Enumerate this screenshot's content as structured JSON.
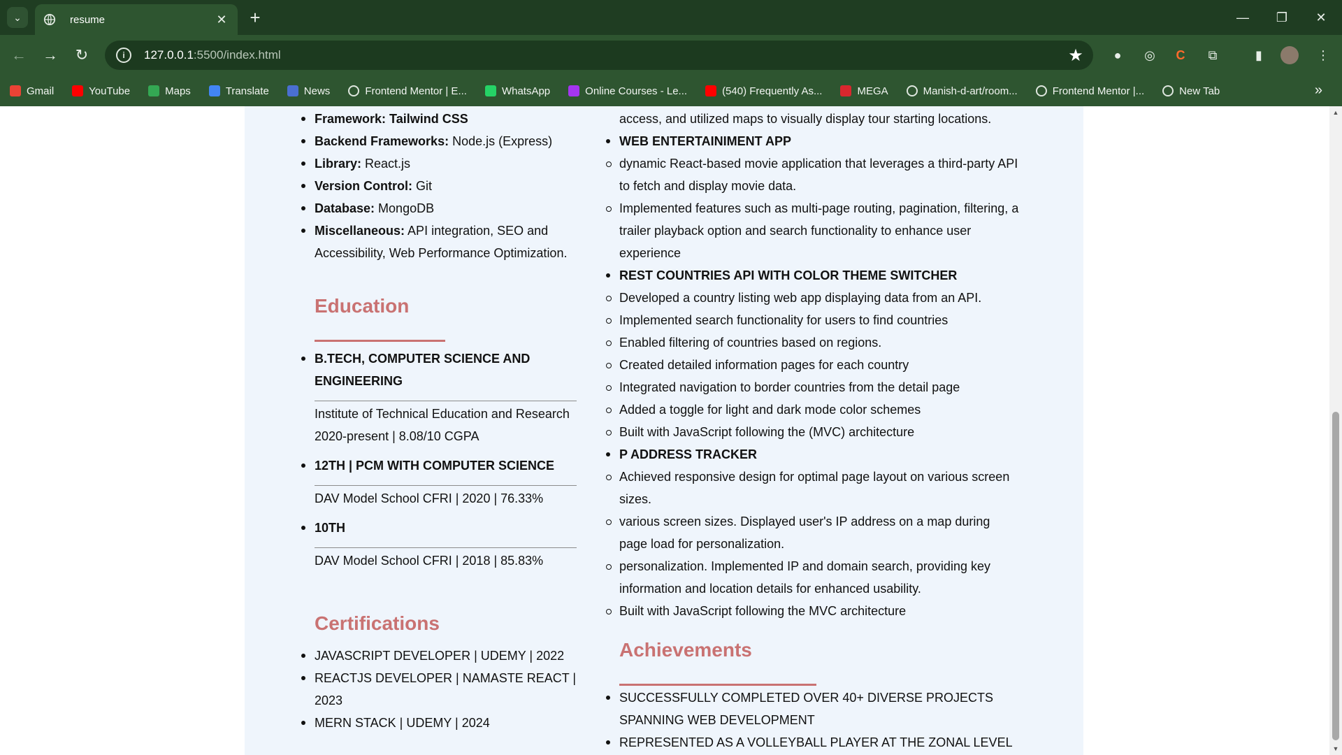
{
  "browser": {
    "tab_title": "resume",
    "url_host": "127.0.0.1",
    "url_path": ":5500/index.html",
    "bookmarks": [
      {
        "label": "Gmail",
        "icon": "gmail-icon",
        "color": "#ea4335"
      },
      {
        "label": "YouTube",
        "icon": "youtube-icon",
        "color": "#ff0000"
      },
      {
        "label": "Maps",
        "icon": "maps-icon",
        "color": "#34a853"
      },
      {
        "label": "Translate",
        "icon": "translate-icon",
        "color": "#4285f4"
      },
      {
        "label": "News",
        "icon": "news-icon",
        "color": "#4a6fd1"
      },
      {
        "label": "Frontend Mentor | E...",
        "icon": "frontend-mentor-icon",
        "color": "#ffffff"
      },
      {
        "label": "WhatsApp",
        "icon": "whatsapp-icon",
        "color": "#25d366"
      },
      {
        "label": "Online Courses - Le...",
        "icon": "udemy-icon",
        "color": "#a435f0"
      },
      {
        "label": "(540) Frequently As...",
        "icon": "youtube-icon",
        "color": "#ff0000"
      },
      {
        "label": "MEGA",
        "icon": "mega-icon",
        "color": "#d9272e"
      },
      {
        "label": "Manish-d-art/room...",
        "icon": "github-icon",
        "color": "#ffffff"
      },
      {
        "label": "Frontend Mentor |...",
        "icon": "globe-icon",
        "color": "#ffffff"
      },
      {
        "label": "New Tab",
        "icon": "globe-icon",
        "color": "#ffffff"
      }
    ]
  },
  "skills": {
    "items": [
      {
        "label": "Framework:",
        "value": " Tailwind CSS",
        "value_bold": true
      },
      {
        "label": "Backend Frameworks:",
        "value": " Node.js (Express)"
      },
      {
        "label": "Library:",
        "value": " React.js"
      },
      {
        "label": "Version Control:",
        "value": " Git"
      },
      {
        "label": "Database:",
        "value": " MongoDB"
      },
      {
        "label": "Miscellaneous:",
        "value": " API integration, SEO and Accessibility, Web Performance Optimization."
      }
    ]
  },
  "education": {
    "title": "Education",
    "entries": [
      {
        "degree": "B.TECH, COMPUTER SCIENCE AND ENGINEERING",
        "details": [
          "Institute of Technical Education and Research",
          "2020-present | 8.08/10 CGPA"
        ]
      },
      {
        "degree": "12TH | PCM WITH COMPUTER SCIENCE",
        "details": [
          "DAV Model School CFRI | 2020 | 76.33%"
        ]
      },
      {
        "degree": "10TH",
        "details": [
          "DAV Model School CFRI | 2018 | 85.83%"
        ]
      }
    ]
  },
  "certifications": {
    "title": "Certifications",
    "items": [
      "JAVASCRIPT DEVELOPER | UDEMY | 2022",
      "REACTJS DEVELOPER | NAMASTE REACT | 2023",
      "MERN STACK | UDEMY | 2024"
    ]
  },
  "projects": {
    "continuation": "access, and utilized maps to visually display tour starting locations.",
    "list": [
      {
        "name": "WEB ENTERTAINIMENT APP",
        "points": [
          "dynamic React-based movie application that leverages a third-party API to fetch and display movie data.",
          "Implemented features such as multi-page routing, pagination, filtering, a trailer playback option and search functionality to enhance user experience"
        ]
      },
      {
        "name": "REST COUNTRIES API WITH COLOR THEME SWITCHER",
        "points": [
          "Developed a country listing web app displaying data from an API.",
          "Implemented search functionality for users to find countries",
          "Enabled filtering of countries based on regions.",
          "Created detailed information pages for each country",
          "Integrated navigation to border countries from the detail page",
          "Added a toggle for light and dark mode color schemes",
          "Built with JavaScript following the (MVC) architecture"
        ]
      },
      {
        "name": "P ADDRESS TRACKER",
        "points": [
          "Achieved responsive design for optimal page layout on various screen sizes.",
          "various screen sizes. Displayed user's IP address on a map during page load for personalization.",
          "personalization. Implemented IP and domain search, providing key information and location details for enhanced usability.",
          "Built with JavaScript following the MVC architecture"
        ]
      }
    ]
  },
  "achievements": {
    "title": "Achievements",
    "items": [
      "SUCCESSFULLY COMPLETED OVER 40+ DIVERSE PROJECTS SPANNING WEB DEVELOPMENT",
      "REPRESENTED AS A VOLLEYBALL PLAYER AT THE ZONAL LEVEL"
    ]
  },
  "colors": {
    "accent": "#c97272",
    "panel_bg": "#eff5fc",
    "chrome": "#2e5530"
  }
}
